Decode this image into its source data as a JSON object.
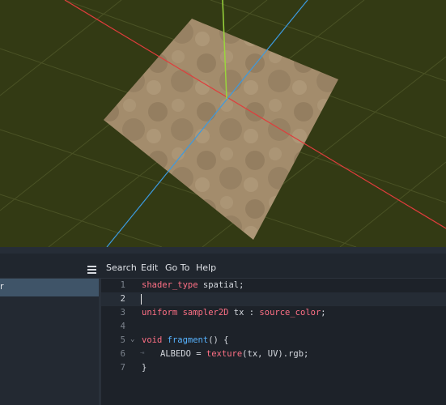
{
  "menu": {
    "search": "Search",
    "edit": "Edit",
    "goto": "Go To",
    "help": "Help"
  },
  "left_panel": {
    "selected_item": "r"
  },
  "code": {
    "line_numbers": [
      "1",
      "2",
      "3",
      "4",
      "5",
      "6",
      "7"
    ],
    "line1": {
      "kw": "shader_type",
      "rest": " spatial;"
    },
    "line3": {
      "kw": "uniform",
      "type": " sampler2D",
      "mid": " tx : ",
      "hint": "source_color",
      "end": ";"
    },
    "line5": {
      "kw": "void",
      "fn": " fragment",
      "rest": "() {"
    },
    "line6": {
      "lhs": "ALBEDO = ",
      "fn": "texture",
      "rest": "(tx, UV).rgb;"
    },
    "line7": {
      "rest": "}"
    },
    "current_line": 2
  },
  "icons": {
    "pane": "list-icon",
    "fold": "chevron-down-icon",
    "tab": "tab-indent-icon"
  },
  "colors": {
    "viewport_bg": "#333a14",
    "editor_bg": "#1d2229",
    "keyword": "#ff7085",
    "function": "#57b3ff",
    "axis_x": "#e03c3c",
    "axis_y": "#9ad63c",
    "axis_z": "#3c9ae0",
    "plane": "#a08a6a"
  }
}
